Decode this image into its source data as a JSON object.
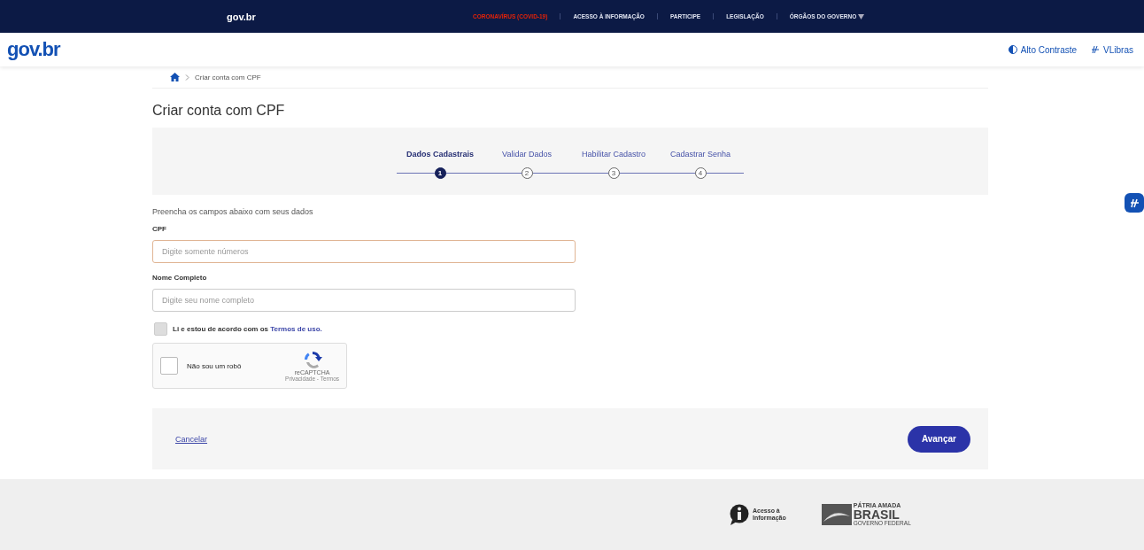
{
  "top_bar": {
    "logo": "gov.br",
    "links": [
      {
        "label": "CORONAVÍRUS (COVID-19)",
        "kind": "alert"
      },
      {
        "label": "ACESSO À INFORMAÇÃO",
        "kind": "normal"
      },
      {
        "label": "PARTICIPE",
        "kind": "normal"
      },
      {
        "label": "LEGISLAÇÃO",
        "kind": "normal"
      },
      {
        "label": "ÓRGÃOS DO GOVERNO",
        "kind": "dropdown"
      }
    ]
  },
  "header": {
    "logo": "gov.br",
    "actions": [
      {
        "label": "Alto Contraste",
        "kind": "contrast"
      },
      {
        "label": "VLibras",
        "kind": "libras"
      }
    ]
  },
  "breadcrumb": {
    "current": "Criar conta com CPF"
  },
  "page_title": "Criar conta com CPF",
  "steps": [
    {
      "label": "Dados Cadastrais",
      "number": "1",
      "selected": true
    },
    {
      "label": "Validar Dados",
      "number": "2",
      "selected": false
    },
    {
      "label": "Habilitar Cadastro",
      "number": "3",
      "selected": false
    },
    {
      "label": "Cadastrar Senha",
      "number": "4",
      "selected": false
    }
  ],
  "intro": "Preencha os campos abaixo com seus dados",
  "fields": [
    {
      "label": "CPF",
      "placeholder": "Digite somente números",
      "focused": true
    },
    {
      "label": "Nome Completo",
      "placeholder": "Digite seu nome completo",
      "focused": false
    }
  ],
  "terms": {
    "text": "Li e estou de acordo com os ",
    "link": "Termos de uso.",
    "checked": false
  },
  "captcha": {
    "label": "Não sou um robô",
    "brand": "reCAPTCHA",
    "footer": "Privacidade - Termos",
    "checked": false
  },
  "actions": {
    "cancel": "Cancelar",
    "next": "Avançar"
  },
  "footer": {
    "info": [
      "Acesso à",
      "Informação"
    ],
    "brand_top": "PÁTRIA AMADA",
    "brand_main": "BRASIL",
    "brand_sub": "GOVERNO FEDERAL"
  }
}
